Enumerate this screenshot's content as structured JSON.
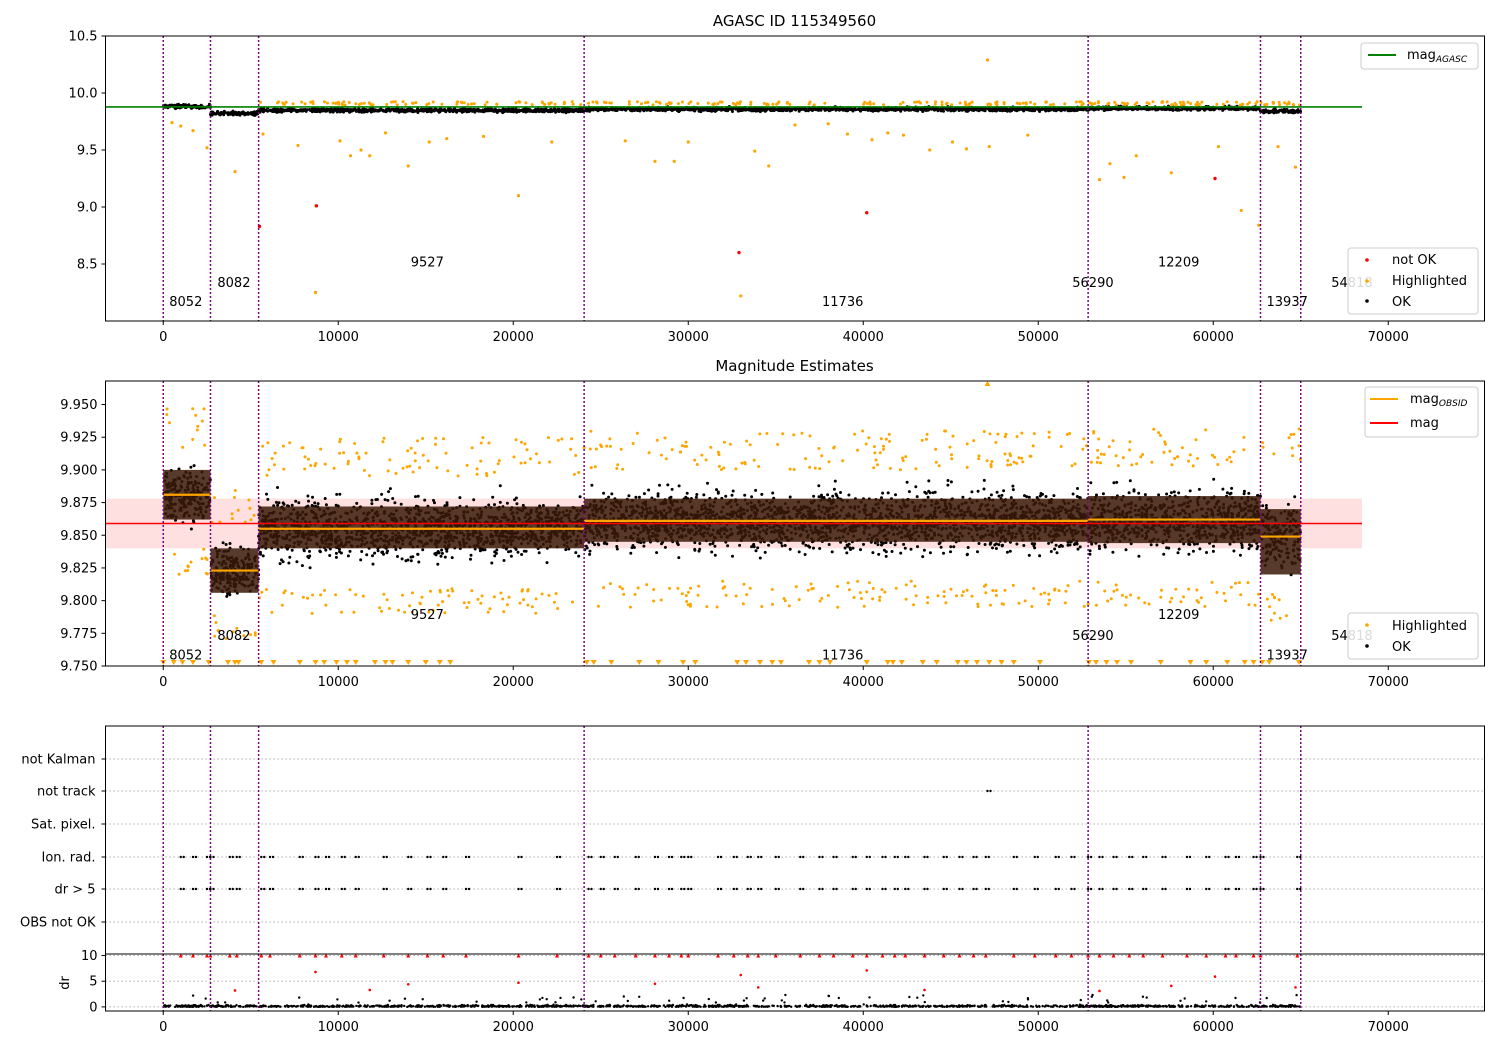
{
  "chart_data": [
    {
      "type": "scatter",
      "title": "AGASC ID 115349560",
      "xlabel": "",
      "ylabel": "",
      "xlim": [
        -3300,
        75500
      ],
      "ylim": [
        8.0,
        10.5
      ],
      "xticks": [
        0,
        10000,
        20000,
        30000,
        40000,
        50000,
        60000,
        70000
      ],
      "xtick_labels": [
        "0",
        "10000",
        "20000",
        "30000",
        "40000",
        "50000",
        "60000",
        "70000"
      ],
      "yticks": [
        8.5,
        9.0,
        9.5,
        10.0,
        10.5
      ],
      "ytick_labels": [
        "8.5",
        "9.0",
        "9.5",
        "10.0",
        "10.5"
      ],
      "grid": false,
      "obsid_boundaries": [
        0,
        2700,
        5450,
        24050,
        52850,
        62700,
        65000
      ],
      "obsid_labels": [
        {
          "x": 0,
          "y": 8.13,
          "label": "8052"
        },
        {
          "x": 2750,
          "y": 8.3,
          "label": "8082"
        },
        {
          "x": 13800,
          "y": 8.48,
          "label": "9527"
        },
        {
          "x": 37300,
          "y": 8.13,
          "label": "11736"
        },
        {
          "x": 51600,
          "y": 8.3,
          "label": "56290"
        },
        {
          "x": 56500,
          "y": 8.48,
          "label": "12209"
        },
        {
          "x": 62700,
          "y": 8.13,
          "label": "13937"
        },
        {
          "x": 66400,
          "y": 8.3,
          "label": "54818"
        }
      ],
      "reference_lines": [
        {
          "name": "mag",
          "subscript": "AGASC",
          "y": 9.878,
          "x_range": [
            -3300,
            68500
          ],
          "color": "#008000"
        }
      ],
      "band_means": [
        {
          "x": [
            0,
            2700
          ],
          "y": 9.882
        },
        {
          "x": [
            2700,
            5450
          ],
          "y": 9.822
        },
        {
          "x": [
            5450,
            24050
          ],
          "y": 9.848
        },
        {
          "x": [
            24050,
            52850
          ],
          "y": 9.858
        },
        {
          "x": [
            52850,
            62700
          ],
          "y": 9.865
        },
        {
          "x": [
            62700,
            65000
          ],
          "y": 9.84
        }
      ],
      "series": [
        {
          "name": "not OK",
          "color": "#ff0000",
          "points": [
            [
              8750,
              9.01
            ],
            [
              32900,
              8.6
            ],
            [
              40200,
              8.95
            ],
            [
              60100,
              9.25
            ],
            [
              5500,
              8.83
            ]
          ]
        },
        {
          "name": "Highlighted",
          "color": "#ffa500",
          "points": [
            [
              500,
              9.74
            ],
            [
              1000,
              9.71
            ],
            [
              1700,
              9.67
            ],
            [
              2500,
              9.52
            ],
            [
              4100,
              9.31
            ],
            [
              5700,
              9.64
            ],
            [
              7700,
              9.54
            ],
            [
              8700,
              8.25
            ],
            [
              10100,
              9.58
            ],
            [
              10700,
              9.45
            ],
            [
              11300,
              9.5
            ],
            [
              11800,
              9.45
            ],
            [
              12700,
              9.65
            ],
            [
              14000,
              9.36
            ],
            [
              15200,
              9.57
            ],
            [
              16200,
              9.6
            ],
            [
              18300,
              9.62
            ],
            [
              20300,
              9.1
            ],
            [
              22200,
              9.57
            ],
            [
              26400,
              9.58
            ],
            [
              28100,
              9.4
            ],
            [
              29200,
              9.4
            ],
            [
              30000,
              9.57
            ],
            [
              33000,
              8.22
            ],
            [
              33800,
              9.49
            ],
            [
              34600,
              9.36
            ],
            [
              36100,
              9.72
            ],
            [
              38000,
              9.73
            ],
            [
              39100,
              9.64
            ],
            [
              40500,
              9.59
            ],
            [
              41400,
              9.65
            ],
            [
              42300,
              9.63
            ],
            [
              43800,
              9.5
            ],
            [
              45100,
              9.57
            ],
            [
              45900,
              9.51
            ],
            [
              47100,
              10.29
            ],
            [
              47200,
              9.53
            ],
            [
              49400,
              9.63
            ],
            [
              53500,
              9.24
            ],
            [
              54100,
              9.38
            ],
            [
              54900,
              9.26
            ],
            [
              55600,
              9.45
            ],
            [
              57600,
              9.3
            ],
            [
              60300,
              9.53
            ],
            [
              61600,
              8.97
            ],
            [
              62600,
              8.84
            ],
            [
              63700,
              9.53
            ],
            [
              64700,
              9.35
            ]
          ]
        },
        {
          "name": "OK",
          "color": "#000000",
          "description": "dense band of per-observation magnitudes near 9.82–9.91"
        }
      ],
      "legends": [
        {
          "position": "upper right",
          "entries": [
            {
              "name": "mag",
              "subscript": "AGASC"
            }
          ]
        },
        {
          "position": "lower right",
          "entries": [
            {
              "name": "not OK"
            },
            {
              "name": "Highlighted"
            },
            {
              "name": "OK"
            }
          ]
        }
      ]
    },
    {
      "type": "scatter",
      "title": "Magnitude Estimates",
      "xlabel": "",
      "ylabel": "",
      "xlim": [
        -3300,
        75500
      ],
      "ylim": [
        9.75,
        9.968
      ],
      "xticks": [
        0,
        10000,
        20000,
        30000,
        40000,
        50000,
        60000,
        70000
      ],
      "xtick_labels": [
        "0",
        "10000",
        "20000",
        "30000",
        "40000",
        "50000",
        "60000",
        "70000"
      ],
      "yticks": [
        9.75,
        9.775,
        9.8,
        9.825,
        9.85,
        9.875,
        9.9,
        9.925,
        9.95
      ],
      "ytick_labels": [
        "9.750",
        "9.775",
        "9.800",
        "9.825",
        "9.850",
        "9.875",
        "9.900",
        "9.925",
        "9.950"
      ],
      "grid": false,
      "obsid_boundaries": [
        0,
        2700,
        5450,
        24050,
        52850,
        62700,
        65000
      ],
      "obsid_labels": [
        {
          "x": 0,
          "y": 9.755,
          "label": "8052"
        },
        {
          "x": 2750,
          "y": 9.77,
          "label": "8082"
        },
        {
          "x": 13800,
          "y": 9.786,
          "label": "9527"
        },
        {
          "x": 37300,
          "y": 9.755,
          "label": "11736"
        },
        {
          "x": 51600,
          "y": 9.77,
          "label": "56290"
        },
        {
          "x": 56500,
          "y": 9.786,
          "label": "12209"
        },
        {
          "x": 62700,
          "y": 9.755,
          "label": "13937"
        },
        {
          "x": 66400,
          "y": 9.77,
          "label": "54818"
        }
      ],
      "mag": {
        "name": "mag",
        "y": 9.859,
        "band": [
          9.84,
          9.878
        ],
        "x_range": [
          -3300,
          68500
        ],
        "color": "#ff0000"
      },
      "obsid_segments": [
        {
          "x": [
            0,
            2700
          ],
          "mean": 9.881,
          "band": [
            9.862,
            9.9
          ],
          "spread": [
            9.84,
            9.922
          ]
        },
        {
          "x": [
            2700,
            5450
          ],
          "mean": 9.823,
          "band": [
            9.806,
            9.84
          ],
          "spread": [
            9.79,
            9.862
          ]
        },
        {
          "x": [
            5450,
            24050
          ],
          "mean": 9.855,
          "band": [
            9.84,
            9.872
          ],
          "spread": [
            9.81,
            9.9
          ]
        },
        {
          "x": [
            24050,
            52850
          ],
          "mean": 9.861,
          "band": [
            9.845,
            9.878
          ],
          "spread": [
            9.815,
            9.905
          ]
        },
        {
          "x": [
            52850,
            62700
          ],
          "mean": 9.862,
          "band": [
            9.844,
            9.88
          ],
          "spread": [
            9.815,
            9.908
          ]
        },
        {
          "x": [
            62700,
            65000
          ],
          "mean": 9.849,
          "band": [
            9.82,
            9.87
          ],
          "spread": [
            9.805,
            9.908
          ]
        }
      ],
      "legends": [
        {
          "position": "upper right",
          "entries": [
            {
              "name": "mag",
              "subscript": "OBSID"
            },
            {
              "name": "mag"
            }
          ]
        },
        {
          "position": "lower right",
          "entries": [
            {
              "name": "Highlighted"
            },
            {
              "name": "OK"
            }
          ]
        }
      ]
    },
    {
      "type": "scatter",
      "title": "",
      "ylabel": "",
      "xlim": [
        -3300,
        75500
      ],
      "flag_rows": [
        "not Kalman",
        "not track",
        "Sat. pixel.",
        "Ion. rad.",
        "dr > 5",
        "OBS not OK"
      ],
      "flag_points": {
        "not track": [
          47100
        ],
        "Ion. rad.": [
          1000,
          1700,
          2500,
          2700,
          3800,
          4200,
          5600,
          6100,
          7800,
          8700,
          9300,
          10200,
          11000,
          12600,
          14000,
          15100,
          16000,
          17300,
          20300,
          22500,
          24300,
          25000,
          25800,
          27000,
          28100,
          28900,
          29600,
          30000,
          31700,
          32600,
          33400,
          34000,
          35000,
          36400,
          37500,
          38300,
          39400,
          40200,
          41100,
          41800,
          42400,
          43500,
          44600,
          45500,
          46300,
          47000,
          48600,
          49800,
          51000,
          51900,
          52850,
          53500,
          54300,
          55200,
          56000,
          57100,
          58500,
          59600,
          60700,
          61300,
          62300,
          62700,
          64800
        ],
        "dr > 5": [
          1000,
          1700,
          2500,
          2700,
          3800,
          4200,
          5600,
          6100,
          7800,
          8700,
          9300,
          10200,
          11000,
          12600,
          14000,
          15100,
          16000,
          17300,
          20300,
          22500,
          24300,
          25000,
          25800,
          27000,
          28100,
          28900,
          29600,
          30000,
          31700,
          32600,
          33400,
          34000,
          35000,
          36400,
          37500,
          38300,
          39400,
          40200,
          41100,
          41800,
          42400,
          43500,
          44600,
          45500,
          46300,
          47000,
          48600,
          49800,
          51000,
          51900,
          52850,
          53500,
          54300,
          55200,
          56000,
          57100,
          58500,
          59600,
          60700,
          61300,
          62300,
          62700,
          64800
        ]
      }
    },
    {
      "type": "scatter",
      "title": "",
      "xlabel": "",
      "ylabel": "dr",
      "xlim": [
        -3300,
        75500
      ],
      "ylim": [
        -0.8,
        10.3
      ],
      "yticks": [
        0,
        5,
        10
      ],
      "ytick_labels": [
        "0",
        "5",
        "10"
      ],
      "xticks": [
        0,
        10000,
        20000,
        30000,
        40000,
        50000,
        60000,
        70000
      ],
      "xtick_labels": [
        "0",
        "10000",
        "20000",
        "30000",
        "40000",
        "50000",
        "60000",
        "70000"
      ],
      "high_points": [
        [
          8700,
          6.8
        ],
        [
          40200,
          7.1
        ],
        [
          33000,
          6.2
        ],
        [
          60100,
          5.9
        ],
        [
          4100,
          3.2
        ],
        [
          11800,
          3.3
        ],
        [
          14000,
          4.4
        ],
        [
          20300,
          4.7
        ],
        [
          28100,
          4.5
        ],
        [
          34000,
          3.8
        ],
        [
          43500,
          3.3
        ],
        [
          53500,
          3.1
        ],
        [
          57600,
          4.1
        ],
        [
          64700,
          3.8
        ]
      ]
    }
  ]
}
